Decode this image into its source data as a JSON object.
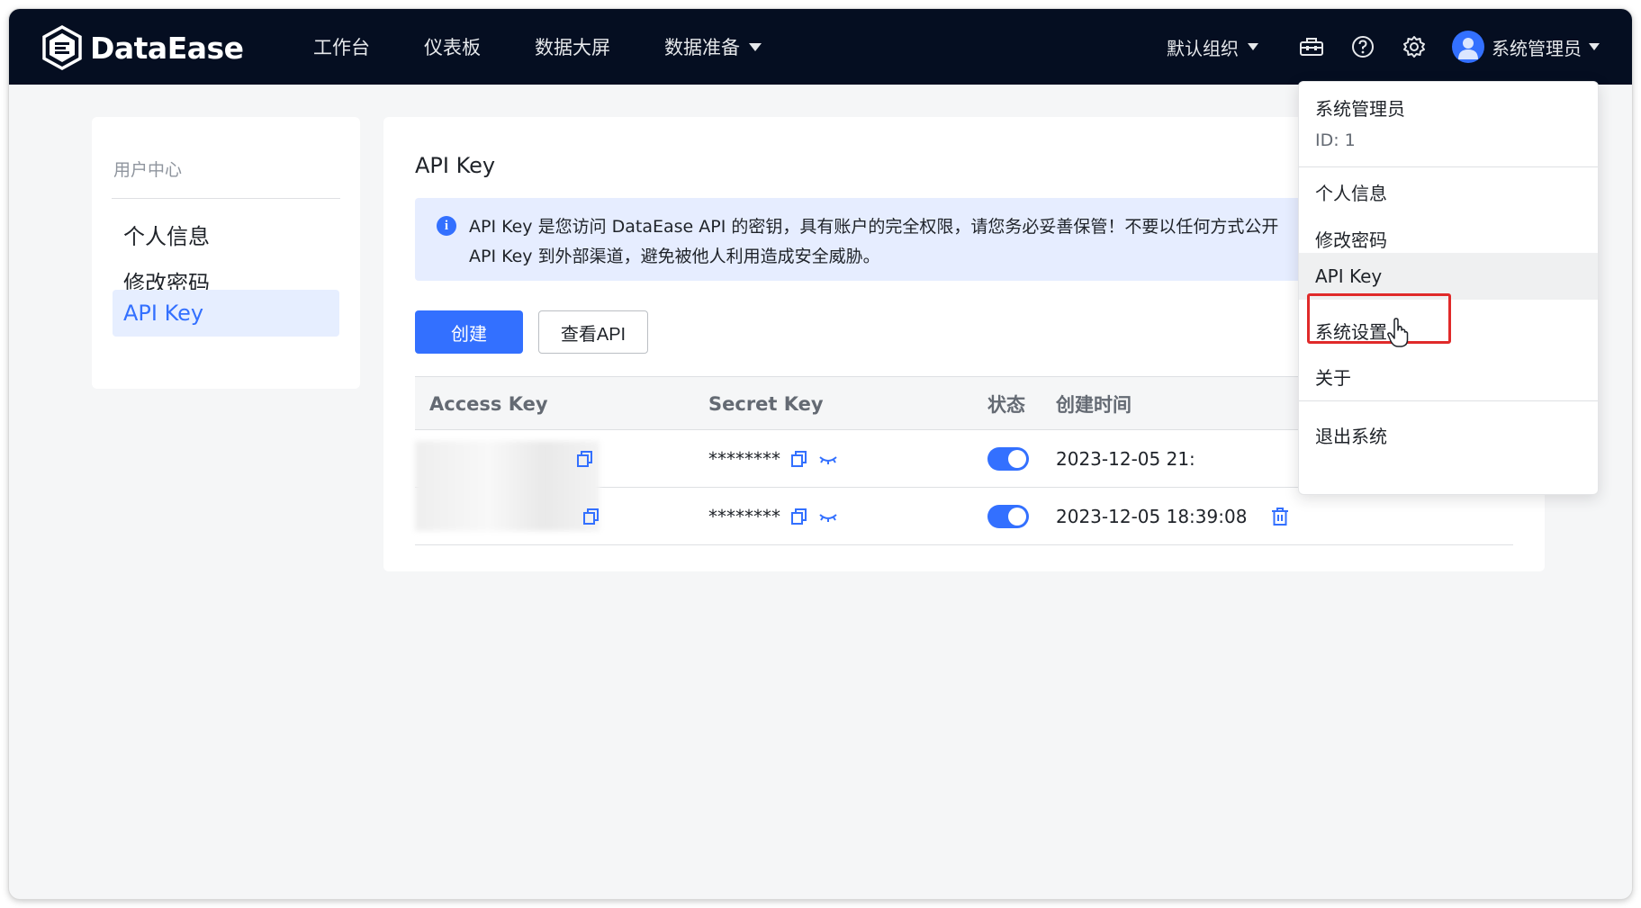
{
  "app": {
    "logo_text": "DataEase"
  },
  "nav": {
    "items": [
      {
        "label": "工作台"
      },
      {
        "label": "仪表板"
      },
      {
        "label": "数据大屏"
      },
      {
        "label": "数据准备"
      }
    ]
  },
  "header_right": {
    "org_label": "默认组织",
    "user_label": "系统管理员",
    "icons": [
      "toolbox-icon",
      "help-icon",
      "gear-icon"
    ]
  },
  "sidebar": {
    "title": "用户中心",
    "items": [
      {
        "label": "个人信息",
        "active": false
      },
      {
        "label": "修改密码",
        "active": false
      },
      {
        "label": "API Key",
        "active": true
      }
    ]
  },
  "main": {
    "title": "API Key",
    "alert_text": "API Key 是您访问 DataEase API 的密钥，具有账户的完全权限，请您务必妥善保管！不要以任何方式公开 API Key 到外部渠道，避免被他人利用造成安全威胁。",
    "create_button": "创建",
    "view_api_button": "查看API",
    "table": {
      "columns": [
        "Access Key",
        "Secret Key",
        "状态",
        "创建时间"
      ],
      "rows": [
        {
          "secret": "********",
          "enabled": true,
          "created": "2023-12-05 21:"
        },
        {
          "secret": "********",
          "enabled": true,
          "created": "2023-12-05 18:39:08"
        }
      ]
    }
  },
  "dropdown": {
    "user_name": "系统管理员",
    "user_id": "ID:  1",
    "items": [
      {
        "label": "个人信息"
      },
      {
        "label": "修改密码"
      },
      {
        "label": "API  Key",
        "hovered": true
      },
      {
        "label": "系统设置"
      },
      {
        "label": "关于"
      },
      {
        "label": "退出系统"
      }
    ]
  },
  "colors": {
    "header_bg": "#050e21",
    "accent": "#3370ff",
    "highlight_border": "#e02a2a"
  }
}
